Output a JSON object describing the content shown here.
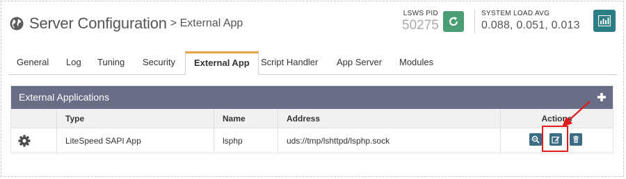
{
  "header": {
    "title": "Server Configuration",
    "subtitle": "> External App",
    "lsws_pid_label": "LSWS PID",
    "lsws_pid_value": "50275",
    "system_load_label": "SYSTEM LOAD AVG",
    "system_load_value": "0.088, 0.051, 0.013"
  },
  "tabs": [
    {
      "label": "General"
    },
    {
      "label": "Log"
    },
    {
      "label": "Tuning"
    },
    {
      "label": "Security"
    },
    {
      "label": "External App",
      "active": true
    },
    {
      "label": "Script Handler"
    },
    {
      "label": "App Server"
    },
    {
      "label": "Modules"
    }
  ],
  "panel": {
    "title": "External Applications",
    "columns": [
      "",
      "Type",
      "Name",
      "Address",
      "Actions"
    ],
    "rows": [
      {
        "type": "LiteSpeed SAPI App",
        "name": "lsphp",
        "address": "uds://tmp/lshttpd/lsphp.sock"
      }
    ]
  },
  "icons": {
    "header": "globe-icon",
    "refresh": "refresh-icon",
    "chart": "bar-chart-icon",
    "add": "plus-icon",
    "row": "gear-icon",
    "view": "zoom-icon",
    "edit": "edit-icon",
    "delete": "trash-icon"
  },
  "colors": {
    "panel_header": "#6a6d86",
    "active_tab_accent": "#e7a24a",
    "refresh_button": "#4b9e74",
    "chart_button": "#2b7d86",
    "action_button": "#3d6d84",
    "annotation": "#e01b1b"
  }
}
